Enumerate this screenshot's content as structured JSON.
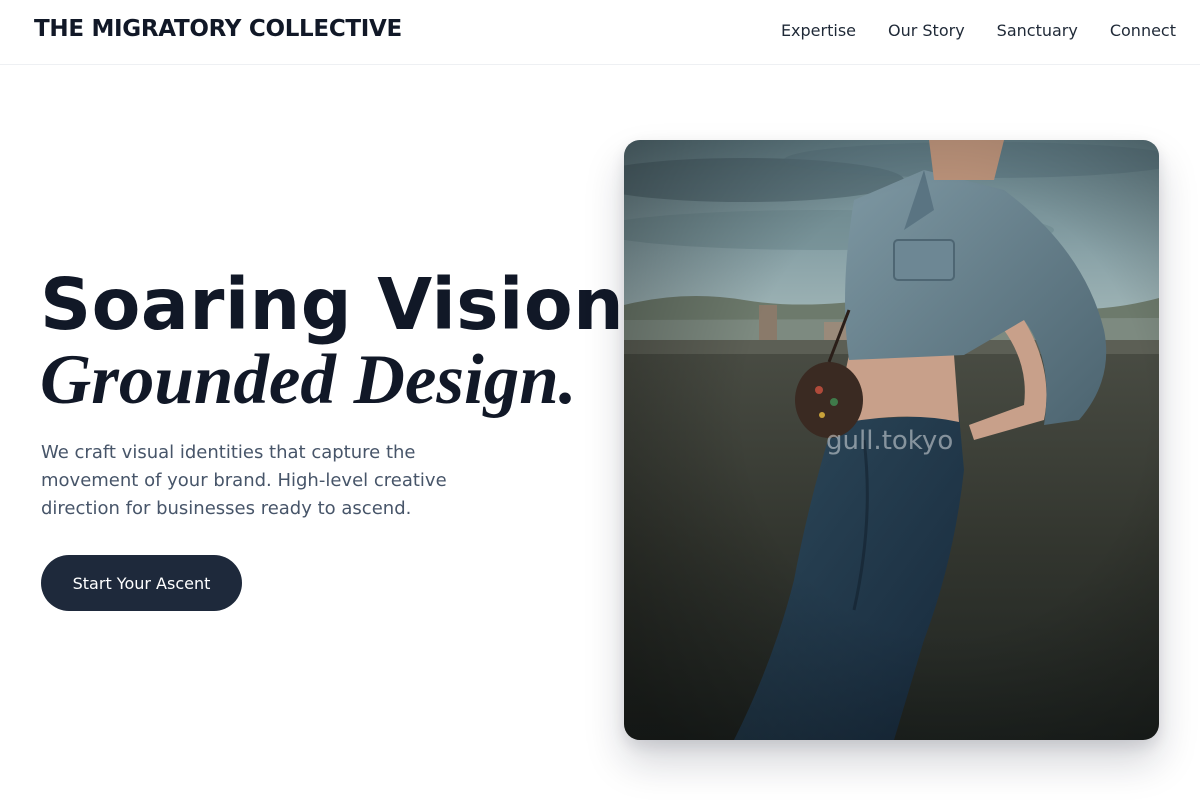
{
  "brand": {
    "name": "THE MIGRATORY COLLECTIVE"
  },
  "nav": {
    "items": [
      {
        "label": "Expertise"
      },
      {
        "label": "Our Story"
      },
      {
        "label": "Sanctuary"
      },
      {
        "label": "Connect"
      }
    ]
  },
  "hero": {
    "title_line1": "Soaring Vision,",
    "title_line2": "Grounded Design.",
    "description": "We craft visual identities that capture the movement of your brand. High-level creative direction for businesses ready to ascend.",
    "cta_label": "Start Your Ascent"
  },
  "photo": {
    "watermark": "gull.tokyo"
  },
  "colors": {
    "text_primary": "#111827",
    "text_muted": "#475569",
    "button_bg": "#1e293b",
    "button_text": "#ffffff"
  }
}
